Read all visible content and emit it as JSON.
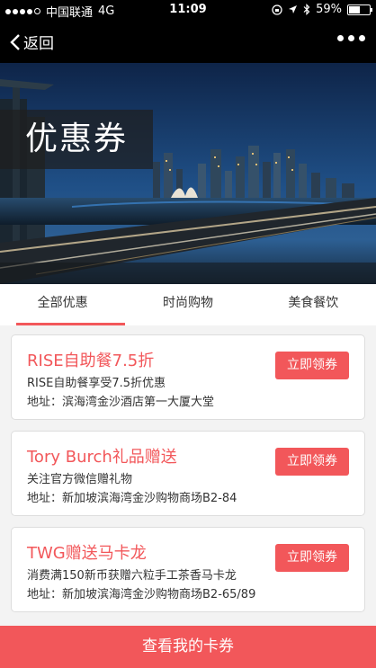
{
  "status_bar": {
    "carrier": "中国联通",
    "network": "4G",
    "time": "11:09",
    "battery": "59%",
    "battery_level": 0.59,
    "signal_bars_filled": 4,
    "icons": [
      "lock-rotation-icon",
      "location-arrow-icon",
      "bluetooth-icon"
    ]
  },
  "nav": {
    "back_label": "返回",
    "more_icon": "more-dots-icon"
  },
  "hero": {
    "title": "优惠券"
  },
  "tabs": [
    {
      "label": "全部优惠",
      "active": true
    },
    {
      "label": "时尚购物",
      "active": false
    },
    {
      "label": "美食餐饮",
      "active": false
    }
  ],
  "coupons": [
    {
      "title": "RISE自助餐7.5折",
      "desc": "RISE自助餐享受7.5折优惠",
      "address": "地址：滨海湾金沙酒店第一大厦大堂",
      "button": "立即领券"
    },
    {
      "title": "Tory Burch礼品赠送",
      "desc": "关注官方微信赠礼物",
      "address": "地址：新加坡滨海湾金沙购物商场B2-84",
      "button": "立即领券"
    },
    {
      "title": "TWG赠送马卡龙",
      "desc": "消费满150新币获赠六粒手工茶香马卡龙",
      "address": "地址：新加坡滨海湾金沙购物商场B2-65/89",
      "button": "立即领券"
    }
  ],
  "bottom_button": "查看我的卡券",
  "colors": {
    "accent": "#f2575a",
    "bar": "#000000",
    "background": "#f3f3f3"
  }
}
